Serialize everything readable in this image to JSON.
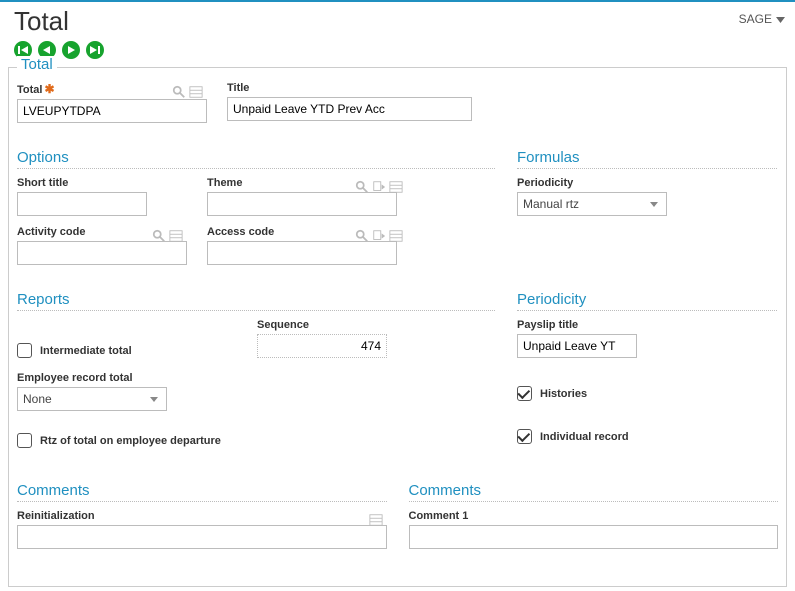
{
  "header": {
    "page_title": "Total",
    "sage_label": "SAGE"
  },
  "panel": {
    "title": "Total",
    "total_field": {
      "label": "Total",
      "value": "LVEUPYTDPA"
    },
    "title_field": {
      "label": "Title",
      "value": "Unpaid Leave YTD Prev Acc"
    }
  },
  "options": {
    "heading": "Options",
    "short_title": {
      "label": "Short title",
      "value": ""
    },
    "activity_code": {
      "label": "Activity code",
      "value": ""
    },
    "theme": {
      "label": "Theme",
      "value": ""
    },
    "access_code": {
      "label": "Access code",
      "value": ""
    }
  },
  "formulas": {
    "heading": "Formulas",
    "periodicity": {
      "label": "Periodicity",
      "value": "Manual rtz"
    }
  },
  "reports": {
    "heading": "Reports",
    "intermediate_total": {
      "label": "Intermediate total",
      "checked": false
    },
    "sequence": {
      "label": "Sequence",
      "value": "474"
    },
    "employee_record_total": {
      "label": "Employee record total",
      "value": "None"
    },
    "rtz_departure": {
      "label": "Rtz of total on employee departure",
      "checked": false
    }
  },
  "periodicity": {
    "heading": "Periodicity",
    "payslip_title": {
      "label": "Payslip title",
      "value": "Unpaid Leave YT"
    },
    "histories": {
      "label": "Histories",
      "checked": true
    },
    "individual_record": {
      "label": "Individual record",
      "checked": true
    }
  },
  "comments_left": {
    "heading": "Comments",
    "reinitialization": {
      "label": "Reinitialization",
      "value": ""
    }
  },
  "comments_right": {
    "heading": "Comments",
    "comment1": {
      "label": "Comment 1",
      "value": ""
    }
  }
}
